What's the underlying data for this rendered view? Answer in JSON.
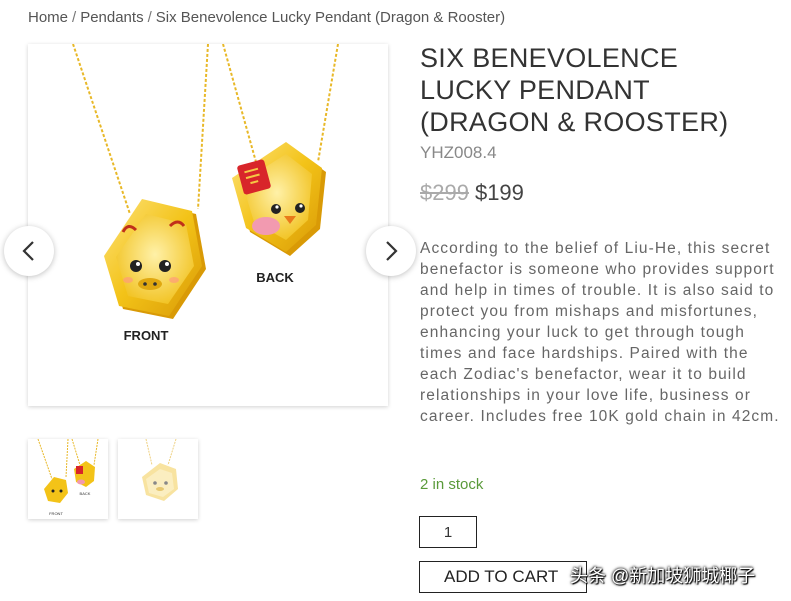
{
  "breadcrumb": {
    "home": "Home",
    "separator": "/",
    "category": "Pendants",
    "current": "Six Benevolence Lucky Pendant (Dragon & Rooster)"
  },
  "gallery": {
    "labels": {
      "front": "FRONT",
      "back": "BACK"
    },
    "prev_icon": "chevron-left-icon",
    "next_icon": "chevron-right-icon",
    "thumbnail_count": 2
  },
  "product": {
    "title": "SIX BENEVOLENCE LUCKY PENDANT (DRAGON & ROOSTER)",
    "sku": "YHZ008.4",
    "price_old": "$299",
    "price_new": "$199",
    "description": "According to the belief of Liu-He, this secret benefactor is someone who provides support and help in times of trouble. It is also said to protect you from mishaps and misfortunes, enhancing your luck to get through tough times and face hardships. Paired with the each Zodiac's benefactor, wear it to build relationships in your love life, business or career. Includes free 10K gold chain in 42cm.",
    "stock": "2 in stock",
    "quantity": "1",
    "add_to_cart": "ADD TO CART"
  },
  "watermark": "头条 @新加坡狮城椰子",
  "colors": {
    "gold": "#f2c21a",
    "stock_green": "#5a9a3a"
  }
}
